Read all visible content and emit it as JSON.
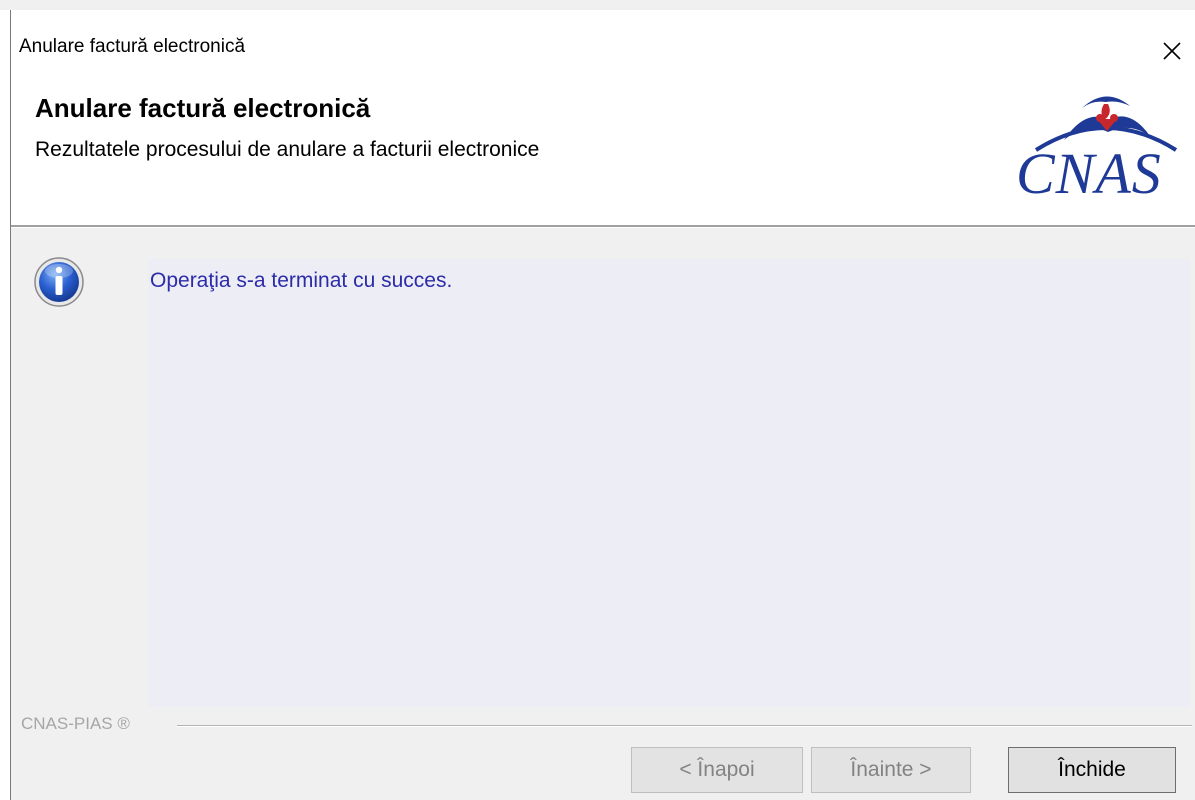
{
  "window": {
    "title": "Anulare factură electronică"
  },
  "header": {
    "title": "Anulare factură electronică",
    "subtitle": "Rezultatele procesului de anulare a facturii electronice",
    "logo_text": "CNAS"
  },
  "content": {
    "icon": "info-icon",
    "message": "Operaţia s-a terminat cu succes."
  },
  "footer": {
    "label": "CNAS-PIAS ®"
  },
  "buttons": {
    "back": {
      "label": "< Înapoi",
      "enabled": false
    },
    "next": {
      "label": "Înainte >",
      "enabled": false
    },
    "close": {
      "label": "Închide",
      "enabled": true
    }
  },
  "colors": {
    "brand": "#1e3a96",
    "message_text": "#2c2ca8",
    "message_bg": "#ededf6",
    "dialog_bg": "#f0f0f0"
  }
}
